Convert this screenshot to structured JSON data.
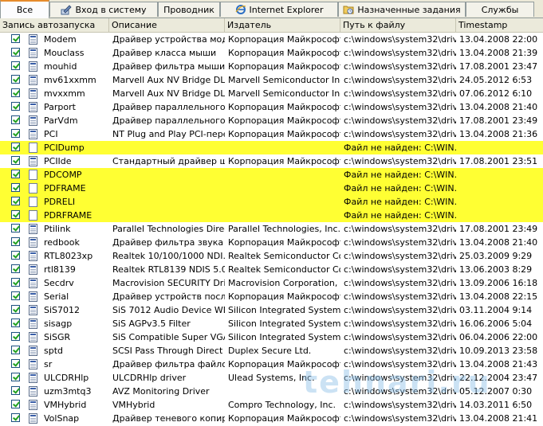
{
  "tabs": [
    {
      "label": "Все",
      "icon": "",
      "active": true
    },
    {
      "label": "Вход в систему",
      "icon": "logon-icon"
    },
    {
      "label": "Проводник",
      "icon": ""
    },
    {
      "label": "Internet Explorer",
      "icon": "internet-explorer-icon"
    },
    {
      "label": "Назначенные задания",
      "icon": "scheduled-tasks-icon"
    },
    {
      "label": "Службы",
      "icon": ""
    }
  ],
  "columns": [
    "Запись автозапуска",
    "Описание",
    "Издатель",
    "Путь к файлу",
    "Timestamp"
  ],
  "rows": [
    {
      "name": "Modem",
      "desc": "Драйвер устройства мод...",
      "pub": "Корпорация Майкрософт",
      "path": "c:\\windows\\system32\\drive...",
      "ts": "13.04.2008 22:00",
      "hl": false
    },
    {
      "name": "Mouclass",
      "desc": "Драйвер класса мыши",
      "pub": "Корпорация Майкрософт",
      "path": "c:\\windows\\system32\\drive...",
      "ts": "13.04.2008 21:39",
      "hl": false
    },
    {
      "name": "mouhid",
      "desc": "Драйвер фильтра мыши ...",
      "pub": "Корпорация Майкрософт",
      "path": "c:\\windows\\system32\\drive...",
      "ts": "17.08.2001 23:47",
      "hl": false
    },
    {
      "name": "mv61xxmm",
      "desc": "Marvell Aux NV Bridge DLL",
      "pub": "Marvell Semiconductor Inc.",
      "path": "c:\\windows\\system32\\drive...",
      "ts": "24.05.2012 6:53",
      "hl": false
    },
    {
      "name": "mvxxmm",
      "desc": "Marvell Aux NV Bridge DLL",
      "pub": "Marvell Semiconductor Inc.",
      "path": "c:\\windows\\system32\\drive...",
      "ts": "07.06.2012 6:10",
      "hl": false
    },
    {
      "name": "Parport",
      "desc": "Драйвер параллельного ...",
      "pub": "Корпорация Майкрософт",
      "path": "c:\\windows\\system32\\drive...",
      "ts": "13.04.2008 21:40",
      "hl": false
    },
    {
      "name": "ParVdm",
      "desc": "Драйвер параллельного ...",
      "pub": "Корпорация Майкрософт",
      "path": "c:\\windows\\system32\\drive...",
      "ts": "17.08.2001 23:49",
      "hl": false
    },
    {
      "name": "PCI",
      "desc": "NT Plug and Play PCI-пере...",
      "pub": "Корпорация Майкрософт",
      "path": "c:\\windows\\system32\\drive...",
      "ts": "13.04.2008 21:36",
      "hl": false
    },
    {
      "name": "PCIDump",
      "desc": "",
      "pub": "",
      "path": "Файл не найден: C:\\WIN...",
      "ts": "",
      "hl": true
    },
    {
      "name": "PCIIde",
      "desc": "Стандартный драйвер ши...",
      "pub": "Корпорация Майкрософт",
      "path": "c:\\windows\\system32\\drive...",
      "ts": "17.08.2001 23:51",
      "hl": false
    },
    {
      "name": "PDCOMP",
      "desc": "",
      "pub": "",
      "path": "Файл не найден: C:\\WIN...",
      "ts": "",
      "hl": true
    },
    {
      "name": "PDFRAME",
      "desc": "",
      "pub": "",
      "path": "Файл не найден: C:\\WIN...",
      "ts": "",
      "hl": true
    },
    {
      "name": "PDRELI",
      "desc": "",
      "pub": "",
      "path": "Файл не найден: C:\\WIN...",
      "ts": "",
      "hl": true
    },
    {
      "name": "PDRFRAME",
      "desc": "",
      "pub": "",
      "path": "Файл не найден: C:\\WIN...",
      "ts": "",
      "hl": true
    },
    {
      "name": "Ptilink",
      "desc": "Parallel Technologies Direct...",
      "pub": "Parallel Technologies, Inc.",
      "path": "c:\\windows\\system32\\drive...",
      "ts": "17.08.2001 23:49",
      "hl": false
    },
    {
      "name": "redbook",
      "desc": "Драйвер фильтра звука \"...",
      "pub": "Корпорация Майкрософт",
      "path": "c:\\windows\\system32\\drive...",
      "ts": "13.04.2008 21:40",
      "hl": false
    },
    {
      "name": "RTL8023xp",
      "desc": "Realtek 10/100/1000 NDI...",
      "pub": "Realtek Semiconductor Cor...",
      "path": "c:\\windows\\system32\\drive...",
      "ts": "25.03.2009 9:29",
      "hl": false
    },
    {
      "name": "rtl8139",
      "desc": "Realtek RTL8139 NDIS 5.0...",
      "pub": "Realtek Semiconductor Cor...",
      "path": "c:\\windows\\system32\\drive...",
      "ts": "13.06.2003 8:29",
      "hl": false
    },
    {
      "name": "Secdrv",
      "desc": "Macrovision SECURITY Dri...",
      "pub": "Macrovision Corporation, M...",
      "path": "c:\\windows\\system32\\drive...",
      "ts": "13.09.2006 16:18",
      "hl": false
    },
    {
      "name": "Serial",
      "desc": "Драйвер устройств после...",
      "pub": "Корпорация Майкрософт",
      "path": "c:\\windows\\system32\\drive...",
      "ts": "13.04.2008 22:15",
      "hl": false
    },
    {
      "name": "SiS7012",
      "desc": "SiS 7012 Audio Device WD...",
      "pub": "Silicon Integrated Systems ...",
      "path": "c:\\windows\\system32\\drive...",
      "ts": "03.11.2004 9:14",
      "hl": false
    },
    {
      "name": "sisagp",
      "desc": "SiS AGPv3.5 Filter",
      "pub": "Silicon Integrated Systems ...",
      "path": "c:\\windows\\system32\\drive...",
      "ts": "16.06.2006 5:04",
      "hl": false
    },
    {
      "name": "SiSGR",
      "desc": "SiS Compatible Super VGA ...",
      "pub": "Silicon Integrated Systems ...",
      "path": "c:\\windows\\system32\\drive...",
      "ts": "06.04.2006 22:00",
      "hl": false
    },
    {
      "name": "sptd",
      "desc": "SCSI Pass Through Direct ...",
      "pub": "Duplex Secure Ltd.",
      "path": "c:\\windows\\system32\\drive...",
      "ts": "10.09.2013 23:58",
      "hl": false
    },
    {
      "name": "sr",
      "desc": "Драйвер фильтра файлов...",
      "pub": "Корпорация Майкрософт",
      "path": "c:\\windows\\system32\\drive...",
      "ts": "13.04.2008 21:43",
      "hl": false
    },
    {
      "name": "ULCDRHlp",
      "desc": "ULCDRHlp driver",
      "pub": "Ulead Systems, Inc.",
      "path": "c:\\windows\\system32\\drive...",
      "ts": "22.12.2004 23:47",
      "hl": false
    },
    {
      "name": "uzm3mtq3",
      "desc": "AVZ Monitoring Driver",
      "pub": "",
      "path": "c:\\windows\\system32\\drive...",
      "ts": "05.12.2007 0:30",
      "hl": false
    },
    {
      "name": "VMHybrid",
      "desc": "VMHybrid",
      "pub": "Compro Technology, Inc.",
      "path": "c:\\windows\\system32\\drive...",
      "ts": "14.03.2011 6:50",
      "hl": false
    },
    {
      "name": "VolSnap",
      "desc": "Драйвер теневого копир...",
      "pub": "Корпорация Майкрософт",
      "path": "c:\\windows\\system32\\drive...",
      "ts": "13.04.2008 21:41",
      "hl": false
    }
  ],
  "watermark": "tehnari.ru",
  "colors": {
    "highlight": "#ffff33",
    "active_tab_accent": "#e68b2c",
    "check": "#21a121"
  }
}
